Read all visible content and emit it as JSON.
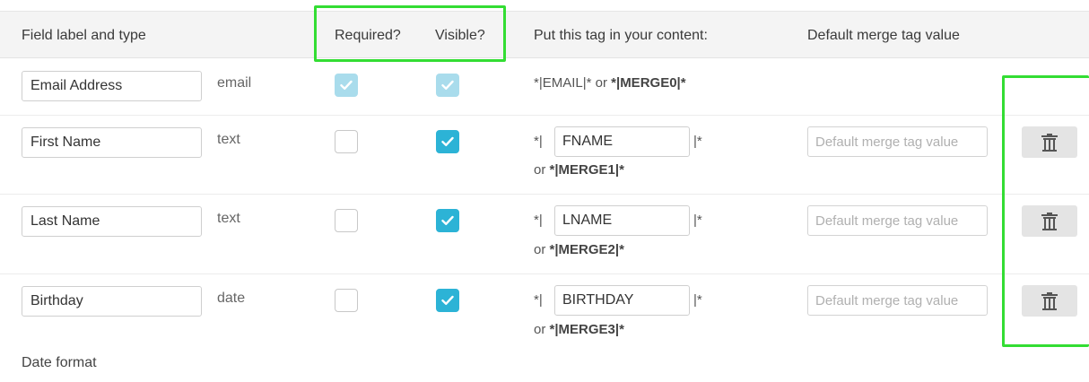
{
  "header": {
    "field_label_and_type": "Field label and type",
    "required": "Required?",
    "visible": "Visible?",
    "put_tag": "Put this tag in your content:",
    "default_value": "Default merge tag value"
  },
  "rows": [
    {
      "label": "Email Address",
      "type": "email",
      "required": true,
      "required_disabled": true,
      "visible": true,
      "visible_disabled": true,
      "tag_prefix": "*|EMAIL|* or ",
      "merge_alias": "*|MERGE0|*"
    },
    {
      "label": "First Name",
      "type": "text",
      "required": false,
      "visible": true,
      "tag_open": "*|",
      "tag_name": "FNAME",
      "tag_close": "|*",
      "or_text": "or ",
      "merge_alias": "*|MERGE1|*",
      "default_placeholder": "Default merge tag value"
    },
    {
      "label": "Last Name",
      "type": "text",
      "required": false,
      "visible": true,
      "tag_open": "*|",
      "tag_name": "LNAME",
      "tag_close": "|*",
      "or_text": "or ",
      "merge_alias": "*|MERGE2|*",
      "default_placeholder": "Default merge tag value"
    },
    {
      "label": "Birthday",
      "type": "date",
      "required": false,
      "visible": true,
      "tag_open": "*|",
      "tag_name": "BIRTHDAY",
      "tag_close": "|*",
      "or_text": "or ",
      "merge_alias": "*|MERGE3|*",
      "default_placeholder": "Default merge tag value"
    }
  ],
  "date_format_label": "Date format",
  "colors": {
    "checkbox_checked": "#2cb3d6",
    "checkbox_disabled": "#a9dcec",
    "highlight": "#33dd33",
    "header_bg": "#f4f4f4"
  },
  "icons": {
    "check": "check-icon",
    "delete": "trash-icon"
  }
}
